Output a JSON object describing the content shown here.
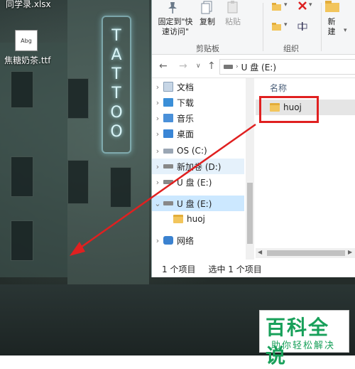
{
  "desktop": {
    "file_xlsx": "同学录.xlsx",
    "file_ttf": "焦糖奶茶.ttf",
    "ttf_icon_text": "Abg",
    "sign_text": "TATTOO"
  },
  "ribbon": {
    "pin_label_line1": "固定到\"快",
    "pin_label_line2": "速访问\"",
    "copy_label": "复制",
    "paste_label": "粘贴",
    "new_label": "新",
    "new_label2": "建",
    "clipboard_group": "剪贴板",
    "organize_group": "组织"
  },
  "address": {
    "path": "U 盘 (E:)"
  },
  "tree": {
    "items": [
      {
        "label": "文档"
      },
      {
        "label": "下载"
      },
      {
        "label": "音乐"
      },
      {
        "label": "桌面"
      },
      {
        "label": "OS (C:)"
      },
      {
        "label": "新加卷 (D:)"
      },
      {
        "label": "U 盘 (E:)"
      },
      {
        "label": "U 盘 (E:)"
      },
      {
        "label": "huoj"
      },
      {
        "label": "网络"
      }
    ]
  },
  "content": {
    "column_name": "名称",
    "files": [
      {
        "name": "huoj"
      }
    ]
  },
  "status": {
    "count": "1 个项目",
    "selected": "选中 1 个项目"
  },
  "watermark": {
    "title": "百科全说",
    "subtitle": "助你轻松解决"
  },
  "colors": {
    "annotation_red": "#e02020",
    "watermark_green": "#18a05a",
    "selection_blue": "#cce8ff"
  }
}
